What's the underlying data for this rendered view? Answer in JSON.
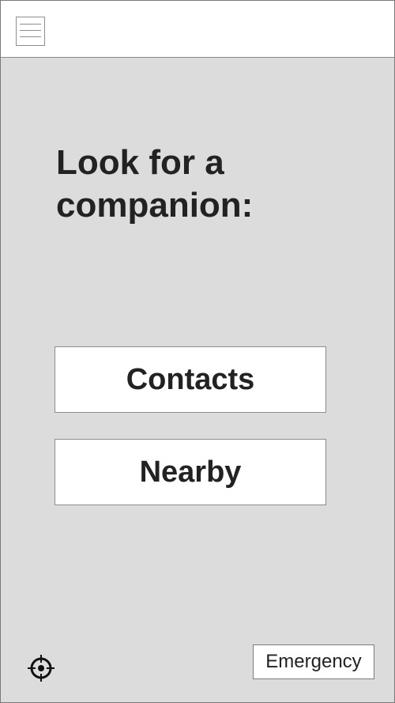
{
  "header": {
    "menu_icon": "hamburger-menu-icon"
  },
  "main": {
    "title": "Look for a companion:",
    "contacts_label": "Contacts",
    "nearby_label": "Nearby"
  },
  "footer": {
    "locate_icon": "crosshair-location-icon",
    "emergency_label": "Emergency"
  },
  "colors": {
    "background": "#dcdcdc",
    "surface": "#ffffff",
    "text": "#222222",
    "border": "#8c8c8c"
  }
}
